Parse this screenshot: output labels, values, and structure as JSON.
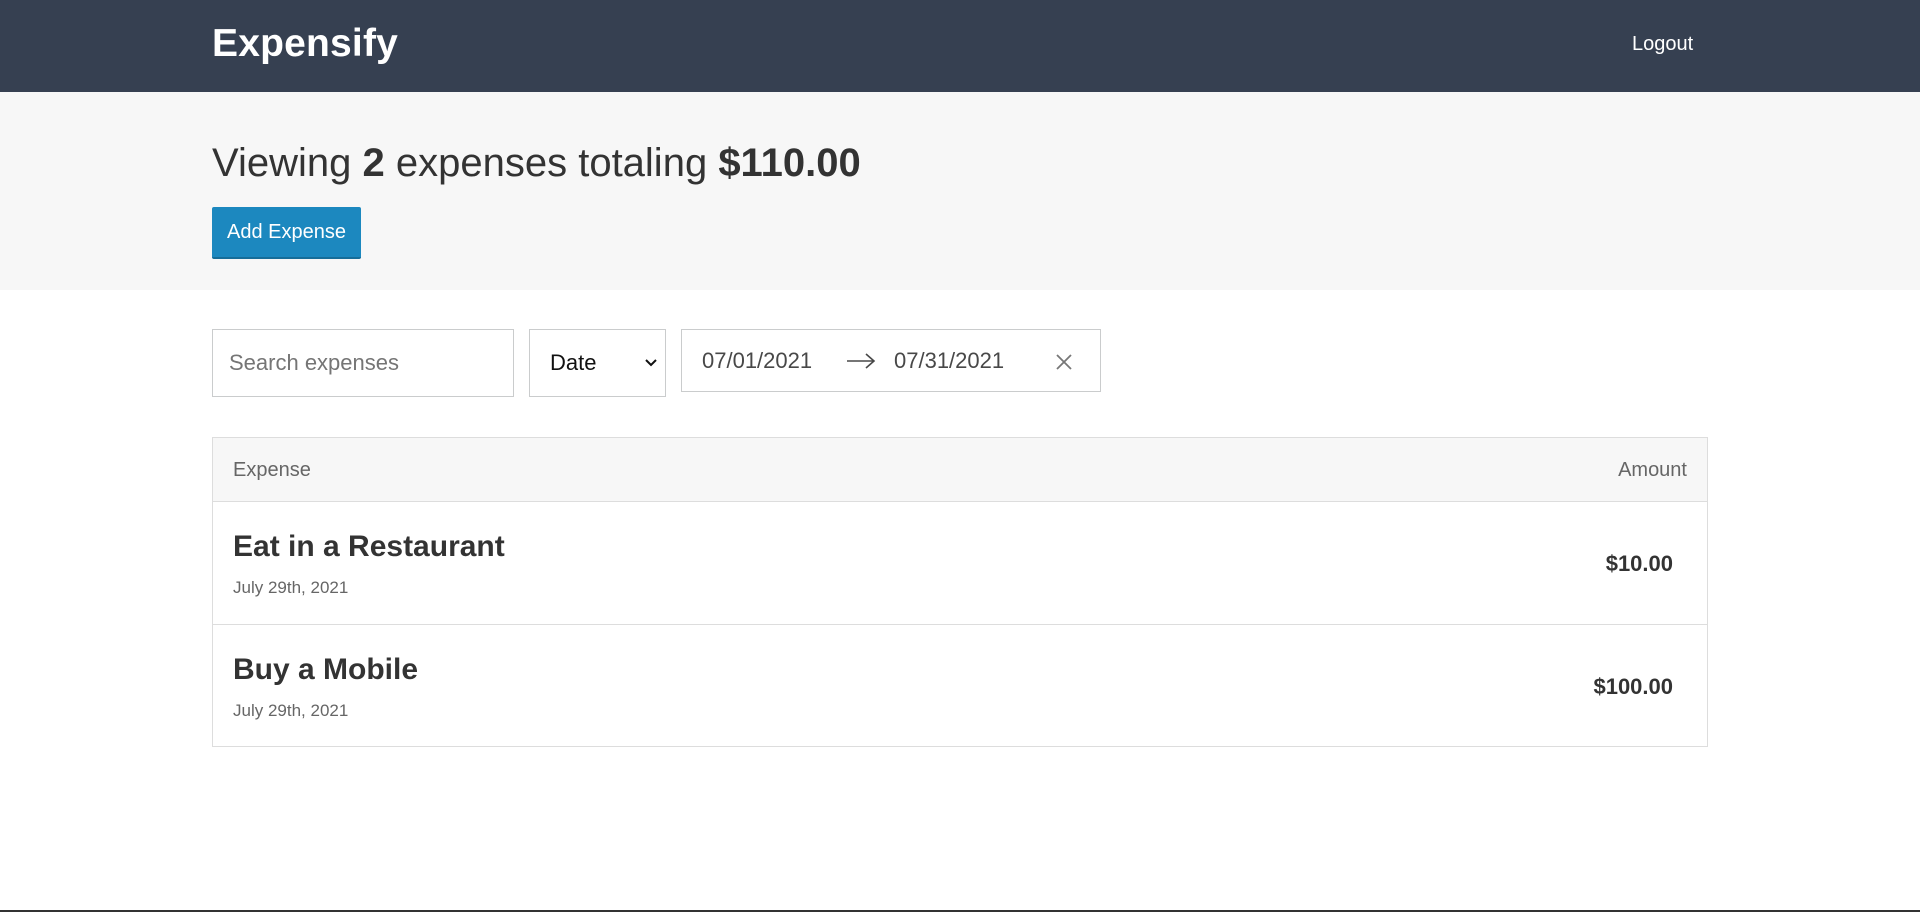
{
  "header": {
    "brand": "Expensify",
    "logout_label": "Logout"
  },
  "summary": {
    "prefix": "Viewing",
    "count": "2",
    "middle": "expenses totaling",
    "total": "$110.00",
    "add_button_label": "Add Expense"
  },
  "filters": {
    "search_placeholder": "Search expenses",
    "search_value": "",
    "sort_selected": "Date",
    "start_date": "07/01/2021",
    "end_date": "07/31/2021"
  },
  "list": {
    "header_left": "Expense",
    "header_right": "Amount",
    "items": [
      {
        "description": "Eat in a Restaurant",
        "date": "July 29th, 2021",
        "amount": "$10.00"
      },
      {
        "description": "Buy a Mobile",
        "date": "July 29th, 2021",
        "amount": "$100.00"
      }
    ]
  },
  "colors": {
    "header_bg": "#364051",
    "button_blue": "#1c88bf",
    "summary_bg": "#f7f7f7"
  },
  "icons": {
    "sort_chevron": "chevron-down-icon",
    "date_arrow": "arrow-right-icon",
    "clear_dates": "close-icon"
  }
}
